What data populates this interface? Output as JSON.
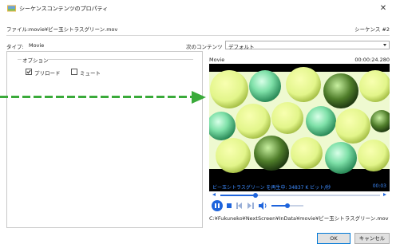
{
  "window": {
    "title": "シーケンスコンテンツのプロパティ",
    "close_glyph": "✕"
  },
  "file_row": {
    "label": "ファイル:",
    "filename": "movie¥ビー玉シトラスグリーン.mov",
    "sequence": "シーケンス #2"
  },
  "type_row": {
    "label": "タイプ:",
    "value": "Movie"
  },
  "next_content": {
    "label": "次のコンテンツ",
    "selected": "デフォルト"
  },
  "options": {
    "group_label": "オプション",
    "preload_label": "プリロード",
    "preload_checked": true,
    "mute_label": "ミュート",
    "mute_checked": false
  },
  "preview": {
    "label": "Movie",
    "time": "00:00:24.280",
    "status": "ビー玉シトラスグリーン  を再生中: 34837 K ビット/秒",
    "status_time": "00:03",
    "progress": 0.22,
    "volume": 0.5,
    "path": "C:¥Fukuneko¥NextScreen¥InData¥movie¥ビー玉シトラスグリーン.mov"
  },
  "icons": {
    "title_icon": "folder-image-icon",
    "play_pause": "pause-icon",
    "stop": "stop-icon",
    "prev": "previous-frame-icon",
    "next": "next-frame-icon",
    "volume": "speaker-icon"
  },
  "buttons": {
    "ok": "OK",
    "cancel": "キャンセル"
  },
  "colors": {
    "accent_arrow": "#3aaa3a",
    "player_accent": "#1e64dc",
    "status_text": "#3e8cff",
    "default_button_border": "#0078d7"
  }
}
